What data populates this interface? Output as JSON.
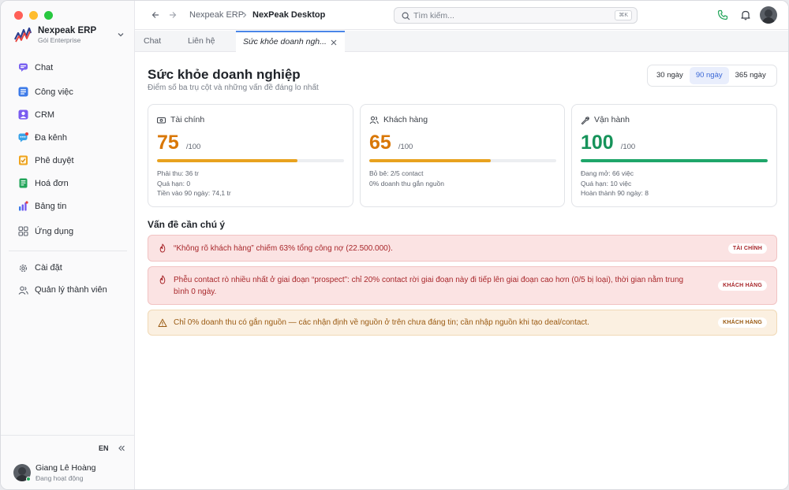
{
  "window": {
    "traffic_colors": [
      "#ff5f57",
      "#febc2e",
      "#28c840"
    ]
  },
  "sidebar": {
    "org_name": "Nexpeak ERP",
    "org_plan": "Gói Enterprise",
    "items": [
      {
        "label": "Chat",
        "icon": "chat-icon",
        "color": "#6b5cf0"
      },
      {
        "label": "Công việc",
        "icon": "tasks-icon",
        "color": "#3d7be8"
      },
      {
        "label": "CRM",
        "icon": "crm-icon",
        "color": "#7a5cf0"
      },
      {
        "label": "Đa kênh",
        "icon": "omnichannel-icon",
        "color": "#3aa3e8"
      },
      {
        "label": "Phê duyệt",
        "icon": "approval-icon",
        "color": "#f0a51f"
      },
      {
        "label": "Hoá đơn",
        "icon": "invoice-icon",
        "color": "#22a55a"
      },
      {
        "label": "Bảng tin",
        "icon": "newsfeed-icon",
        "color": "#6b5cf0"
      },
      {
        "label": "Ứng dụng",
        "icon": "apps-icon",
        "color": "#5f6570"
      }
    ],
    "settings_items": [
      {
        "label": "Cài đặt",
        "icon": "gear-icon"
      },
      {
        "label": "Quản lý thành viên",
        "icon": "members-icon"
      }
    ],
    "lang": "EN",
    "user_name": "Giang Lê Hoàng",
    "user_status": "Đang hoạt động"
  },
  "topbar": {
    "crumb_root": "Nexpeak ERP",
    "crumb_current": "NexPeak Desktop",
    "search_placeholder": "Tìm kiếm...",
    "search_shortcut": "⌘K"
  },
  "tabs": [
    {
      "label": "Chat"
    },
    {
      "label": "Liên hệ"
    },
    {
      "label": "Sức khỏe doanh ngh..."
    }
  ],
  "page": {
    "title": "Sức khỏe doanh nghiệp",
    "subtitle": "Điểm số ba trụ cột và những vấn đề đáng lo nhất",
    "ranges": [
      "30 ngày",
      "90 ngày",
      "365 ngày"
    ],
    "selected_range": "90 ngày",
    "cards": [
      {
        "title": "Tài chính",
        "score": "75",
        "max": "/100",
        "progress": 0.75,
        "color": "#d97706",
        "bar_color": "#e8a21f",
        "stats": [
          "Phải thu: 36 tr",
          "Quá hạn: 0",
          "Tiền vào 90 ngày: 74,1 tr"
        ]
      },
      {
        "title": "Khách hàng",
        "score": "65",
        "max": "/100",
        "progress": 0.65,
        "color": "#d97706",
        "bar_color": "#e8a21f",
        "stats": [
          "Bỏ bê: 2/5 contact",
          "0% doanh thu gắn nguồn"
        ]
      },
      {
        "title": "Vận hành",
        "score": "100",
        "max": "/100",
        "progress": 1.0,
        "color": "#16935a",
        "bar_color": "#1fa66a",
        "stats": [
          "Đang mở: 66 việc",
          "Quá hạn: 10 việc",
          "Hoàn thành 90 ngày: 8"
        ]
      }
    ],
    "issues_title": "Vấn đề cần chú ý",
    "issues": [
      {
        "severity": "red",
        "icon": "flame-icon",
        "text": "“Không rõ khách hàng” chiếm 63% tổng công nợ (22.500.000).",
        "tag": "TÀI CHÍNH"
      },
      {
        "severity": "red",
        "icon": "flame-icon",
        "text": "Phễu contact rò nhiều nhất ở giai đoạn “prospect”: chỉ 20% contact rời giai đoạn này đi tiếp lên giai đoạn cao hơn (0/5 bị loại), thời gian nằm trung bình 0 ngày.",
        "tag": "KHÁCH HÀNG"
      },
      {
        "severity": "amber",
        "icon": "warning-icon",
        "text": "Chỉ 0% doanh thu có gắn nguồn — các nhận định về nguồn ở trên chưa đáng tin; cần nhập nguồn khi tạo deal/contact.",
        "tag": "KHÁCH HÀNG"
      }
    ]
  }
}
